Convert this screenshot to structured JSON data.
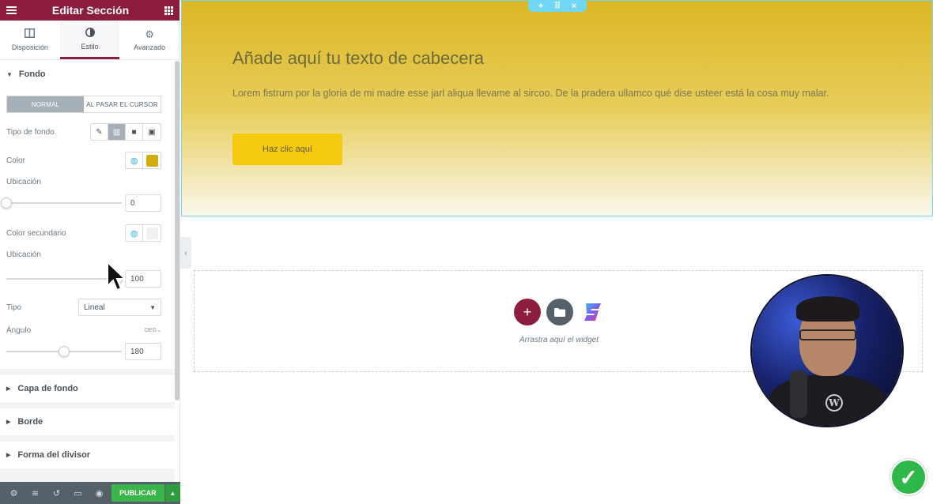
{
  "sidebar": {
    "title": "Editar Sección",
    "tabs": [
      {
        "label": "Disposición",
        "icon": "layout-icon"
      },
      {
        "label": "Estilo",
        "icon": "contrast-icon"
      },
      {
        "label": "Avanzado",
        "icon": "gear-icon"
      }
    ],
    "section_fondo": {
      "title": "Fondo",
      "state_tabs": [
        "NORMAL",
        "AL PASAR EL CURSOR"
      ],
      "tipo_fondo_label": "Tipo de fondo",
      "tipo_fondo_selected": "gradient",
      "color_label": "Color",
      "color_value": "#d4ac0d",
      "ubicacion1_label": "Ubicación",
      "ubicacion1_value": "0",
      "color_secundario_label": "Color secundario",
      "color_secundario_value": "#f1f1f1",
      "ubicacion2_label": "Ubicación",
      "ubicacion2_value": "100",
      "tipo_label": "Tipo",
      "tipo_value": "Lineal",
      "angulo_label": "Ángulo",
      "angulo_unit": "DEG",
      "angulo_value": "180"
    },
    "collapsed_sections": [
      "Capa de fondo",
      "Borde",
      "Forma del divisor"
    ],
    "footer": {
      "publish_label": "PUBLICAR"
    }
  },
  "canvas": {
    "hero": {
      "title": "Añade aquí tu texto de cabecera",
      "text": "Lorem fistrum por la gloria de mi madre esse jarl aliqua llevame al sircoo. De la pradera ullamco qué dise usteer está la cosa muy malar.",
      "button_label": "Haz clic aquí",
      "bg_start": "#dcb624",
      "bg_end": "#faf7ec"
    },
    "dropzone": {
      "text": "Arrastra aquí el widget"
    }
  },
  "colors": {
    "brand": "#8c1d3f",
    "publish": "#39b54a",
    "selection": "#71d7f7"
  }
}
